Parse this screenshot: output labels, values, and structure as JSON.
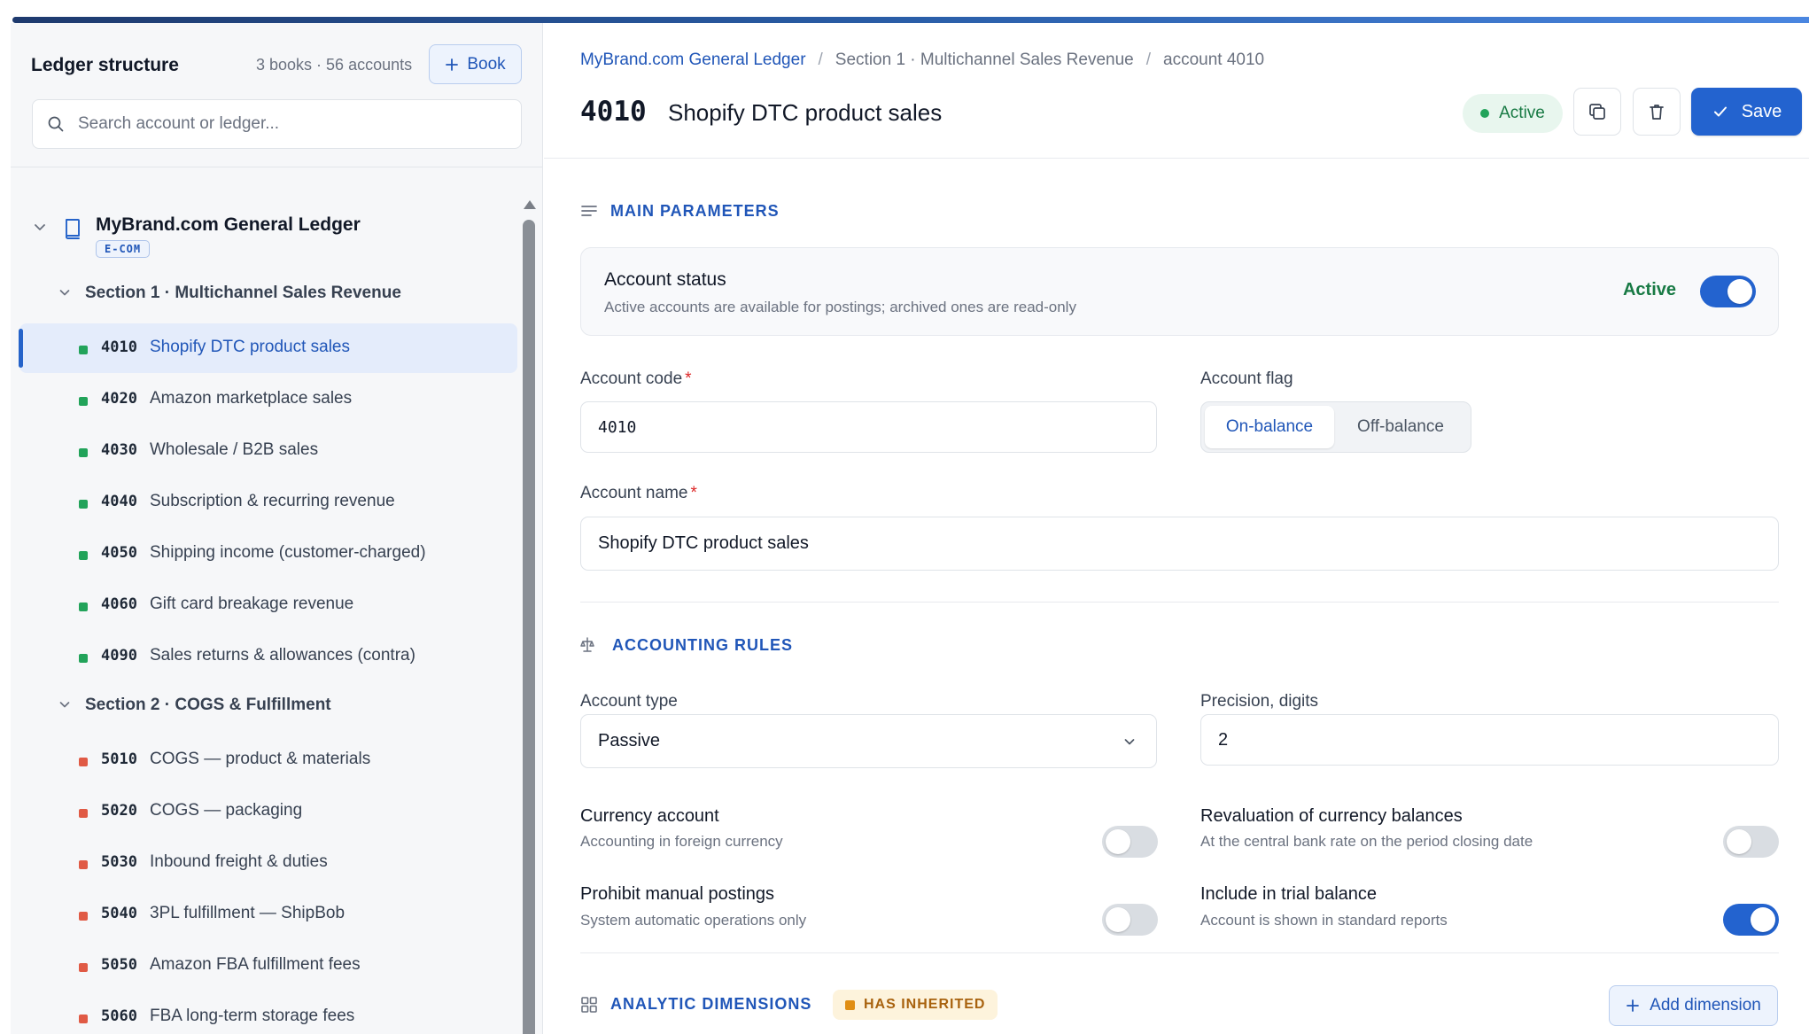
{
  "sidebar": {
    "title": "Ledger structure",
    "counts": "3 books · 56 accounts",
    "book_button": "Book",
    "search_placeholder": "Search account or ledger...",
    "ledger": {
      "name": "MyBrand.com General Ledger",
      "tag": "E-COM"
    },
    "sections": [
      {
        "label": "Section 1 · Multichannel Sales Revenue",
        "color": "#22a35a",
        "accounts": [
          {
            "code": "4010",
            "name": "Shopify DTC product sales",
            "selected": true
          },
          {
            "code": "4020",
            "name": "Amazon marketplace sales"
          },
          {
            "code": "4030",
            "name": "Wholesale / B2B sales"
          },
          {
            "code": "4040",
            "name": "Subscription & recurring revenue"
          },
          {
            "code": "4050",
            "name": "Shipping income (customer-charged)"
          },
          {
            "code": "4060",
            "name": "Gift card breakage revenue"
          },
          {
            "code": "4090",
            "name": "Sales returns & allowances (contra)"
          }
        ]
      },
      {
        "label": "Section 2 · COGS & Fulfillment",
        "color": "#e05a45",
        "accounts": [
          {
            "code": "5010",
            "name": "COGS — product & materials"
          },
          {
            "code": "5020",
            "name": "COGS — packaging"
          },
          {
            "code": "5030",
            "name": "Inbound freight & duties"
          },
          {
            "code": "5040",
            "name": "3PL fulfillment — ShipBob"
          },
          {
            "code": "5050",
            "name": "Amazon FBA fulfillment fees"
          },
          {
            "code": "5060",
            "name": "FBA long-term storage fees"
          }
        ]
      }
    ]
  },
  "breadcrumb": {
    "ledger": "MyBrand.com General Ledger",
    "section": "Section 1 · Multichannel Sales Revenue",
    "account": "account 4010",
    "separator": "/"
  },
  "header": {
    "code": "4010",
    "name": "Shopify DTC product sales",
    "status": "Active",
    "save_label": "Save"
  },
  "main_params": {
    "title": "MAIN PARAMETERS",
    "status_title": "Account status",
    "status_desc": "Active accounts are available for postings; archived ones are read-only",
    "status_value": "Active",
    "status_on": true,
    "code_label": "Account code",
    "code_value": "4010",
    "flag_label": "Account flag",
    "flag_options": [
      "On-balance",
      "Off-balance"
    ],
    "flag_selected": "On-balance",
    "name_label": "Account name",
    "name_value": "Shopify DTC product sales",
    "required_mark": "*"
  },
  "accounting_rules": {
    "title": "ACCOUNTING RULES",
    "type_label": "Account type",
    "type_value": "Passive",
    "precision_label": "Precision, digits",
    "precision_value": "2",
    "options": [
      {
        "title": "Currency account",
        "desc": "Accounting in foreign currency",
        "on": false
      },
      {
        "title": "Revaluation of currency balances",
        "desc": "At the central bank rate on the period closing date",
        "on": false
      },
      {
        "title": "Prohibit manual postings",
        "desc": "System automatic operations only",
        "on": false
      },
      {
        "title": "Include in trial balance",
        "desc": "Account is shown in standard reports",
        "on": true
      }
    ]
  },
  "analytic": {
    "title": "ANALYTIC DIMENSIONS",
    "badge": "HAS INHERITED",
    "add_label": "Add dimension"
  },
  "colors": {
    "accent": "#2363cf",
    "success": "#22a35a",
    "danger": "#e05a45",
    "warning": "#e08e14"
  }
}
